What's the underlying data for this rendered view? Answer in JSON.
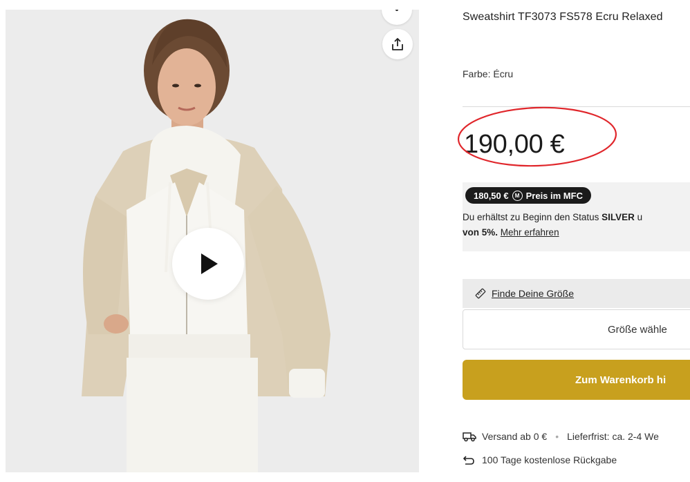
{
  "product": {
    "title": "Sweatshirt TF3073 FS578 Ecru Relaxed",
    "color_label": "Farbe:",
    "color_value": "Écru",
    "price": "190,00 €"
  },
  "media": {
    "top_icon": "more-icon",
    "share_icon": "share-icon",
    "play_icon": "play-icon"
  },
  "mfc": {
    "badge_price": "180,50 €",
    "badge_label": "Preis im MFC",
    "coin_symbol": "M",
    "text_before": "Du erhältst zu Beginn den Status ",
    "status": "SILVER",
    "text_after": " u",
    "discount": "von 5%.",
    "link": "Mehr erfahren"
  },
  "size": {
    "finder_label": "Finde Deine Größe",
    "select_placeholder": "Größe wähle"
  },
  "cart": {
    "button_label": "Zum Warenkorb hi"
  },
  "delivery": {
    "shipping": "Versand ab 0 €",
    "delivery_time": "Lieferfrist: ca. 2-4 We",
    "returns": "100 Tage kostenlose Rückgabe"
  },
  "colors": {
    "accent_gold": "#c8a01e",
    "annotation_red": "#e0262b",
    "badge_dark": "#1b1b1b"
  }
}
